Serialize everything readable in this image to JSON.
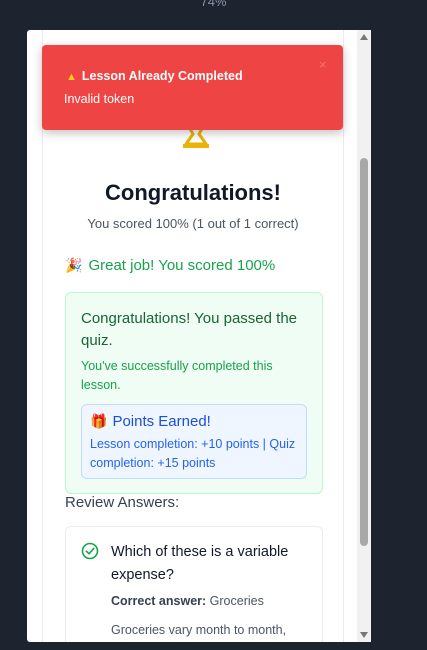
{
  "zoom_label": "74%",
  "toast": {
    "title": "Lesson Already Completed",
    "message": "Invalid token",
    "close_glyph": "×"
  },
  "result": {
    "title": "Congratulations!",
    "score_line": "You scored 100% (1 out of 1 correct)",
    "great_job": "Great job! You scored 100%"
  },
  "success": {
    "title": "Congratulations! You passed the quiz.",
    "subtitle": "You've successfully completed this lesson."
  },
  "points": {
    "title": "Points Earned!",
    "detail": "Lesson completion: +10 points | Quiz completion: +15 points"
  },
  "review": {
    "heading": "Review Answers:",
    "questions": [
      {
        "question": "Which of these is a variable expense?",
        "correct_label": "Correct answer:",
        "correct_value": "Groceries",
        "explanation": "Groceries vary month to month,"
      }
    ]
  },
  "colors": {
    "toast_bg": "#ef4444",
    "success_green": "#16a34a",
    "points_blue": "#1d4ed8",
    "trophy_gold": "#eab308"
  },
  "icons": {
    "toast": "warning-icon",
    "trophy": "trophy-icon",
    "great_job": "party-popper-icon",
    "points": "gift-icon",
    "question": "check-circle-icon"
  }
}
